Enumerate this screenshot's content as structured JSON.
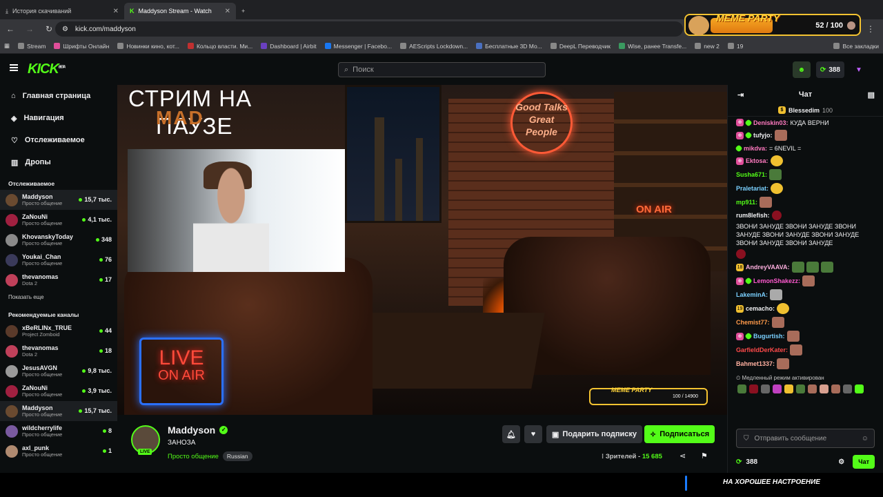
{
  "browser": {
    "tabs": [
      {
        "label": "История скачиваний",
        "active": false
      },
      {
        "label": "Maddyson Stream - Watch",
        "active": true
      }
    ],
    "url": "kick.com/maddyson",
    "bookmarks": [
      "Stream",
      "Шрифты Онлайн",
      "Новинки кино, кот...",
      "Кольцо власти. Ми...",
      "Dashboard | Airbit",
      "Messenger | Facebo...",
      "AEScripts Lockdown...",
      "Бесплатные 3D Мо...",
      "DeepL Переводчик",
      "Wise, ранее Transfe...",
      "new 2",
      "19"
    ],
    "all_bookmarks": "Все закладки"
  },
  "overlay_meme": {
    "title": "MEME PARTY",
    "count": "52 / 100"
  },
  "header": {
    "logo": "KICK",
    "logo_sup": "BETA",
    "search_placeholder": "Поиск",
    "points": "388"
  },
  "sidebar": {
    "nav": [
      "Главная страница",
      "Навигация",
      "Отслеживаемое",
      "Дропы"
    ],
    "followed_title": "Отслеживаемое",
    "followed": [
      {
        "name": "Maddyson",
        "game": "Просто общение",
        "viewers": "15,7 тыс."
      },
      {
        "name": "ZaNouNi",
        "game": "Просто общение",
        "viewers": "4,1 тыс."
      },
      {
        "name": "KhovanskyToday",
        "game": "Просто общение",
        "viewers": "348"
      },
      {
        "name": "Youkai_Chan",
        "game": "Просто общение",
        "viewers": "76"
      },
      {
        "name": "thevanomas",
        "game": "Dota 2",
        "viewers": "17"
      }
    ],
    "show_more": "Показать еще",
    "recommended_title": "Рекомендуемые каналы",
    "recommended": [
      {
        "name": "xBeRLINx_TRUE",
        "game": "Project Zomboid",
        "viewers": "44"
      },
      {
        "name": "thevanomas",
        "game": "Dota 2",
        "viewers": "18"
      },
      {
        "name": "JesusAVGN",
        "game": "Просто общение",
        "viewers": "9,8 тыс."
      },
      {
        "name": "ZaNouNi",
        "game": "Просто общение",
        "viewers": "3,9 тыс."
      },
      {
        "name": "Maddyson",
        "game": "Просто общение",
        "viewers": "15,7 тыс."
      },
      {
        "name": "wildcherrylife",
        "game": "Просто общение",
        "viewers": "8"
      },
      {
        "name": "axl_punk",
        "game": "Просто общение",
        "viewers": "1"
      }
    ]
  },
  "video": {
    "overlay_line1": "СТРИМ НА",
    "overlay_line2": "ПАУЗЕ",
    "mad": "MAD",
    "neon_sign": "Good Talks Great People",
    "on_air": "ON AIR",
    "live_sign_1": "LIVE",
    "live_sign_2": "ON AIR",
    "meme_title": "MEME PARTY",
    "meme_count": "100 / 14900"
  },
  "stream": {
    "streamer": "Maddyson",
    "live": "LIVE",
    "title": "ЗАНОЗА",
    "category": "Просто общение",
    "language": "Russian",
    "gift_label": "Подарить подписку",
    "follow_label": "Подписаться",
    "viewers_label": "Зрителей -",
    "viewers": "15 685"
  },
  "chat": {
    "title": "Чат",
    "pinned_user": "Blessedim",
    "pinned_count": "100",
    "messages": [
      {
        "user": "Deniskin03:",
        "text": "КУДА ВЕРНИ",
        "color": "#ff7ac0"
      },
      {
        "user": "tufyjo:",
        "text": "",
        "color": "#ffffff"
      },
      {
        "user": "mikdva:",
        "text": "= 6NEVIL =",
        "color": "#ff7ac0"
      },
      {
        "user": "Ektosa:",
        "text": "",
        "color": "#ff7ac0"
      },
      {
        "user": "Susha671:",
        "text": "",
        "color": "#53fc18"
      },
      {
        "user": "Praletariat:",
        "text": "",
        "color": "#7ad0ff"
      },
      {
        "user": "mp911:",
        "text": "",
        "color": "#53fc18"
      },
      {
        "user": "rum8lefish:",
        "text": "ЗВОНИ ЗАНУДЕ ЗВОНИ ЗАНУДЕ ЗВОНИ ЗАНУДЕ ЗВОНИ ЗАНУДЕ ЗВОНИ ЗАНУДЕ ЗВОНИ ЗАНУДЕ ЗВОНИ ЗАНУДЕ",
        "color": "#ffffff"
      },
      {
        "user": "AndreyVAAVA:",
        "text": "",
        "color": "#ffb0e0"
      },
      {
        "user": "LemonShakezz:",
        "text": "",
        "color": "#ff5ad0"
      },
      {
        "user": "LakeminA:",
        "text": "",
        "color": "#7ad0ff"
      },
      {
        "user": "cemacho:",
        "text": "",
        "color": "#ffffff"
      },
      {
        "user": "Chemist77:",
        "text": "",
        "color": "#ff9a4a"
      },
      {
        "user": "Bugurtish:",
        "text": "",
        "color": "#7ad0ff"
      },
      {
        "user": "GarfieldDerKater:",
        "text": "",
        "color": "#ff4a4a"
      },
      {
        "user": "Bahmet1337:",
        "text": "",
        "color": "#ffb0a0"
      }
    ],
    "slow_mode": "Медленный режим активирован",
    "input_placeholder": "Отправить сообщение",
    "points": "388",
    "send_label": "Чат"
  },
  "bottom_banner": "НА ХОРОШЕЕ НАСТРОЕНИЕ",
  "colors": {
    "accent": "#53fc18",
    "bg": "#0b0e0f"
  }
}
